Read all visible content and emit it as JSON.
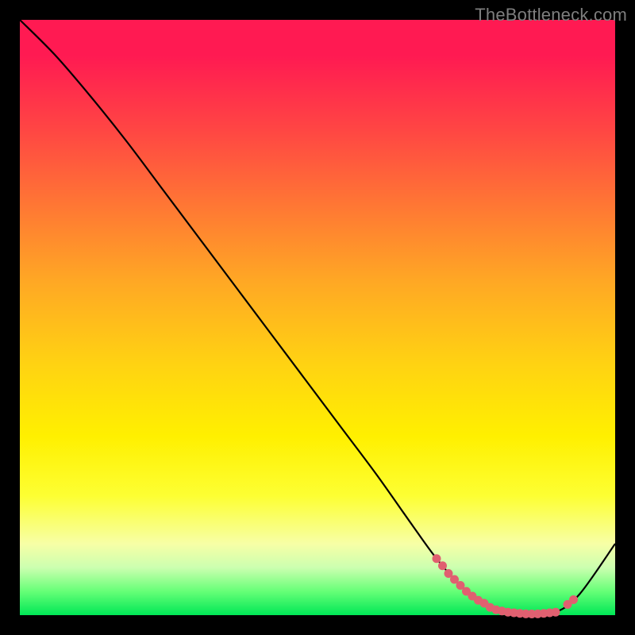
{
  "watermark": "TheBottleneck.com",
  "chart_data": {
    "type": "line",
    "title": "",
    "xlabel": "",
    "ylabel": "",
    "xlim": [
      0,
      100
    ],
    "ylim": [
      0,
      100
    ],
    "grid": false,
    "legend": false,
    "series": [
      {
        "name": "curve",
        "x": [
          0,
          6,
          12,
          18,
          24,
          30,
          36,
          42,
          48,
          54,
          60,
          66,
          70,
          74,
          78,
          82,
          86,
          90,
          94,
          100
        ],
        "y": [
          100,
          94,
          87,
          79.5,
          71.5,
          63.5,
          55.5,
          47.5,
          39.5,
          31.5,
          23.5,
          15,
          9.5,
          5,
          2,
          0.5,
          0.2,
          0.5,
          3.5,
          12
        ],
        "color": "#000000"
      }
    ],
    "markers": [
      {
        "x": 70,
        "y": 9.5,
        "color": "#e06070"
      },
      {
        "x": 71,
        "y": 8.3,
        "color": "#e06070"
      },
      {
        "x": 72,
        "y": 7.0,
        "color": "#e06070"
      },
      {
        "x": 73,
        "y": 6.0,
        "color": "#e06070"
      },
      {
        "x": 74,
        "y": 5.0,
        "color": "#e06070"
      },
      {
        "x": 75,
        "y": 4.0,
        "color": "#e06070"
      },
      {
        "x": 76,
        "y": 3.2,
        "color": "#e06070"
      },
      {
        "x": 77,
        "y": 2.5,
        "color": "#e06070"
      },
      {
        "x": 78,
        "y": 2.0,
        "color": "#e06070"
      },
      {
        "x": 79,
        "y": 1.3,
        "color": "#e06070"
      },
      {
        "x": 80,
        "y": 0.9,
        "color": "#e06070"
      },
      {
        "x": 81,
        "y": 0.7,
        "color": "#e06070"
      },
      {
        "x": 82,
        "y": 0.5,
        "color": "#e06070"
      },
      {
        "x": 83,
        "y": 0.4,
        "color": "#e06070"
      },
      {
        "x": 84,
        "y": 0.3,
        "color": "#e06070"
      },
      {
        "x": 85,
        "y": 0.22,
        "color": "#e06070"
      },
      {
        "x": 86,
        "y": 0.2,
        "color": "#e06070"
      },
      {
        "x": 87,
        "y": 0.22,
        "color": "#e06070"
      },
      {
        "x": 88,
        "y": 0.3,
        "color": "#e06070"
      },
      {
        "x": 89,
        "y": 0.4,
        "color": "#e06070"
      },
      {
        "x": 90,
        "y": 0.5,
        "color": "#e06070"
      },
      {
        "x": 92,
        "y": 1.8,
        "color": "#e06070"
      },
      {
        "x": 93,
        "y": 2.6,
        "color": "#e06070"
      }
    ]
  }
}
